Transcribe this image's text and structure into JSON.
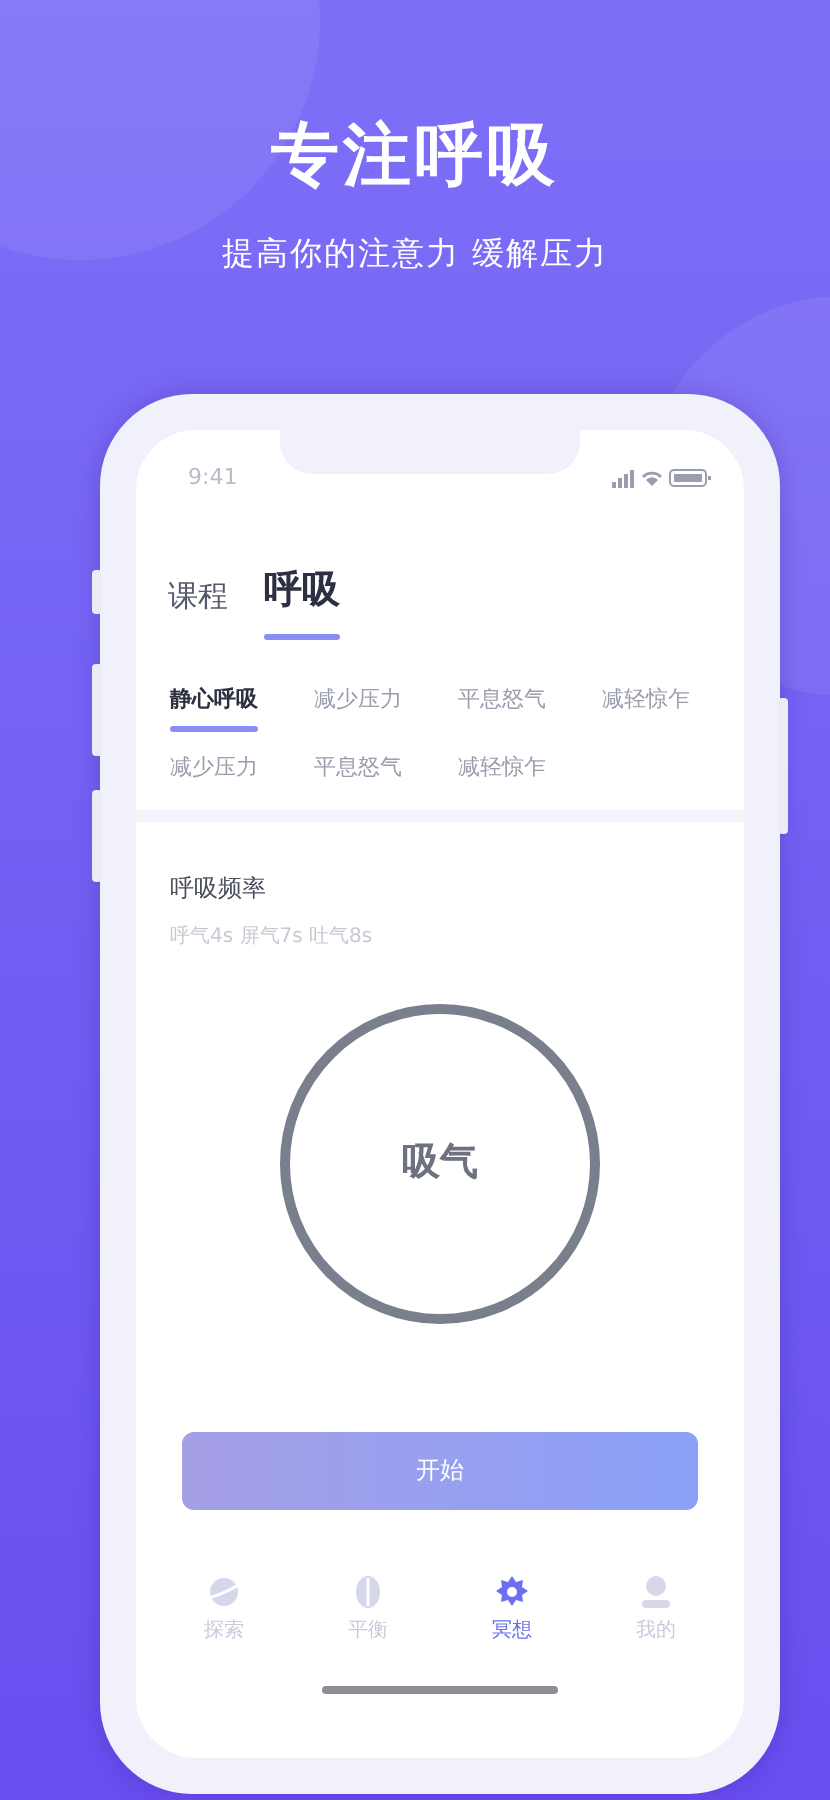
{
  "header": {
    "title": "专注呼吸",
    "subtitle": "提高你的注意力 缓解压力"
  },
  "status_bar": {
    "time": "9:41"
  },
  "tabs": [
    {
      "label": "课程",
      "selected": false
    },
    {
      "label": "呼吸",
      "selected": true
    }
  ],
  "categories": [
    {
      "label": "静心呼吸",
      "selected": true
    },
    {
      "label": "减少压力",
      "selected": false
    },
    {
      "label": "平息怒气",
      "selected": false
    },
    {
      "label": "减轻惊乍",
      "selected": false
    },
    {
      "label": "减少压力",
      "selected": false
    },
    {
      "label": "平息怒气",
      "selected": false
    },
    {
      "label": "减轻惊乍",
      "selected": false
    }
  ],
  "rhythm": {
    "title": "呼吸频率",
    "detail": "呼气4s 屏气7s 吐气8s",
    "phase": "吸气"
  },
  "start_button": "开始",
  "bottom_nav": [
    {
      "label": "探索",
      "selected": false,
      "kind": "planet"
    },
    {
      "label": "平衡",
      "selected": false,
      "kind": "balance"
    },
    {
      "label": "冥想",
      "selected": true,
      "kind": "flower"
    },
    {
      "label": "我的",
      "selected": false,
      "kind": "person"
    }
  ]
}
